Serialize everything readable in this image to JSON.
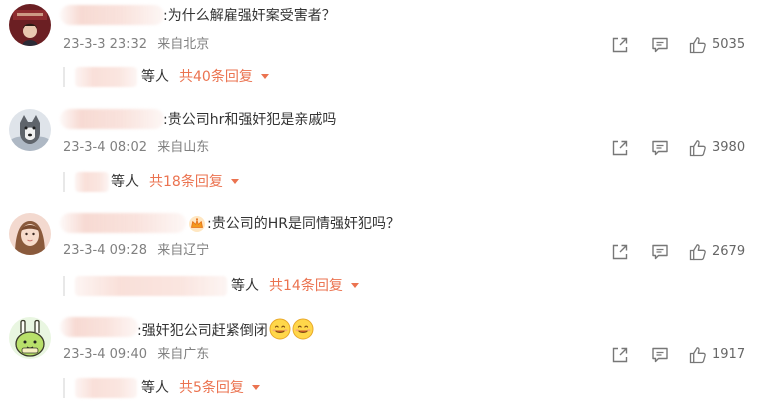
{
  "comments": [
    {
      "text": ":为什么解雇强奸案受害者？",
      "time": "23-3-3 23:32",
      "location": "来自北京",
      "likes": "5035",
      "reply_who": "等人",
      "reply_count": "共40条回复"
    },
    {
      "text": ":贵公司hr和强奸犯是亲戚吗",
      "time": "23-3-4 08:02",
      "location": "来自山东",
      "likes": "3980",
      "reply_who": "等人",
      "reply_count": "共18条回复"
    },
    {
      "text": ":贵公司的HR是同情强奸犯吗？",
      "time": "23-3-4 09:28",
      "location": "来自辽宁",
      "likes": "2679",
      "reply_who": "等人",
      "reply_count": "共14条回复"
    },
    {
      "text": ":强奸犯公司赶紧倒闭",
      "time": "23-3-4 09:40",
      "location": "来自广东",
      "likes": "1917",
      "reply_who": "等人",
      "reply_count": "共5条回复"
    }
  ],
  "icons": {
    "share": "share-icon",
    "comment": "comment-icon",
    "like": "thumbs-up-icon",
    "badge": "crown-badge-icon",
    "emoji": "smiley-emoji-icon",
    "expand": "caret-down-icon"
  },
  "colors": {
    "accent": "#eb7350",
    "meta": "#808080",
    "text": "#333333"
  }
}
